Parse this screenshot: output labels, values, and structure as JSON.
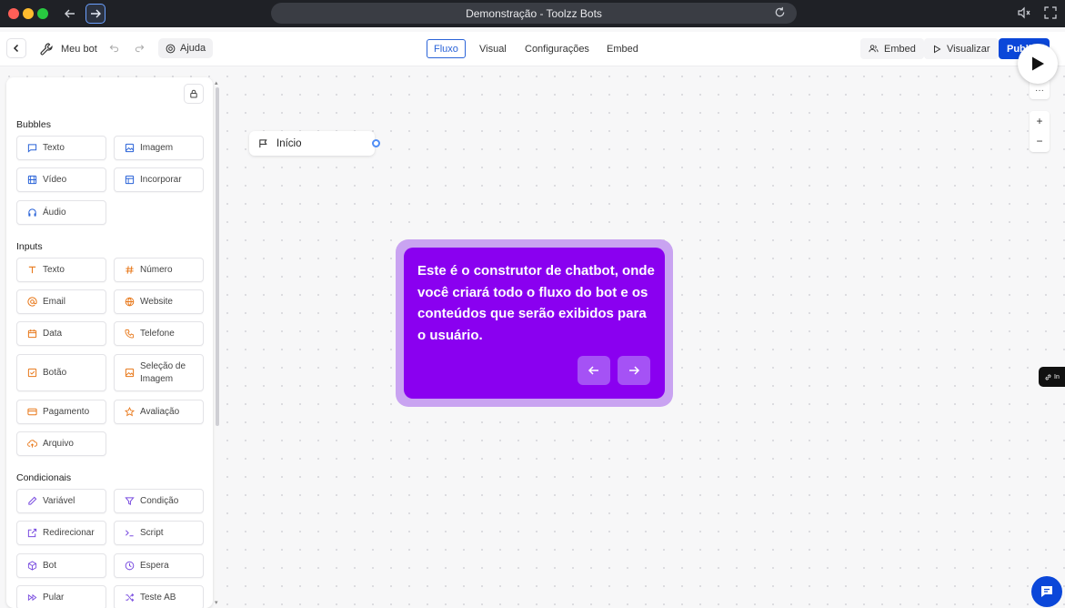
{
  "browser": {
    "url_title": "Demonstração - Toolzz Bots"
  },
  "header": {
    "bot_name": "Meu bot",
    "help_label": "Ajuda",
    "tabs": [
      "Fluxo",
      "Visual",
      "Configurações",
      "Embed"
    ],
    "active_tab": "Fluxo",
    "embed_label": "Embed",
    "preview_label": "Visualizar",
    "publish_label": "Publicar"
  },
  "sidebar": {
    "sections": [
      {
        "title": "Bubbles",
        "items": [
          "Texto",
          "Imagem",
          "Vídeo",
          "Incorporar",
          "Áudio"
        ]
      },
      {
        "title": "Inputs",
        "items": [
          "Texto",
          "Número",
          "Email",
          "Website",
          "Data",
          "Telefone",
          "Botão",
          "Seleção de Imagem",
          "Pagamento",
          "Avaliação",
          "Arquivo"
        ]
      },
      {
        "title": "Condicionais",
        "items": [
          "Variável",
          "Condição",
          "Redirecionar",
          "Script",
          "Bot",
          "Espera",
          "Pular",
          "Teste AB"
        ]
      }
    ]
  },
  "canvas": {
    "start_node_label": "Início",
    "tour_text": "Este é o construtor de chatbot, onde você criará todo o fluxo do bot e os conteúdos que serão exibidos para o usuário.",
    "side_tag_label": "In",
    "zoom_in": "+",
    "zoom_out": "−",
    "more": "···"
  },
  "colors": {
    "accent": "#0b47d9",
    "tour_bg": "#8a00f0",
    "input_icons": "#e8781a",
    "logic_icons": "#7a4de0"
  }
}
